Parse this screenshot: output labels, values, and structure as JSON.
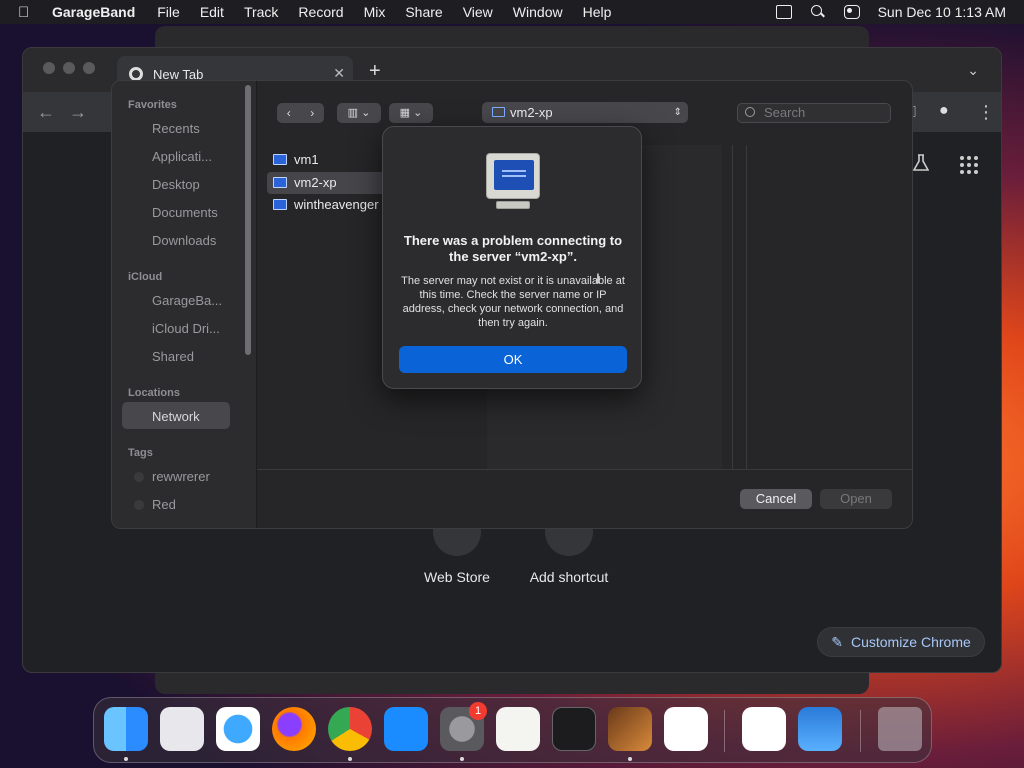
{
  "menubar": {
    "app_name": "GarageBand",
    "items": [
      "File",
      "Edit",
      "Track",
      "Record",
      "Mix",
      "Share",
      "View",
      "Window",
      "Help"
    ],
    "clock": "Sun Dec 10  1:13 AM"
  },
  "chrome": {
    "tab_title": "New Tab",
    "shortcuts": [
      {
        "label": "Web Store"
      },
      {
        "label": "Add shortcut"
      }
    ],
    "customize_label": "Customize Chrome"
  },
  "open_dialog": {
    "sidebar": {
      "favorites_heading": "Favorites",
      "favorites": [
        "Recents",
        "Applicati...",
        "Desktop",
        "Documents",
        "Downloads"
      ],
      "icloud_heading": "iCloud",
      "icloud": [
        "GarageBa...",
        "iCloud Dri...",
        "Shared"
      ],
      "locations_heading": "Locations",
      "locations": [
        "Network"
      ],
      "tags_heading": "Tags",
      "tags": [
        "rewwrerer",
        "Red"
      ]
    },
    "path_label": "vm2-xp",
    "search_placeholder": "Search",
    "files": [
      "vm1",
      "vm2-xp",
      "wintheavenger"
    ],
    "selected_file": "vm2-xp",
    "cancel_label": "Cancel",
    "open_label": "Open"
  },
  "alert": {
    "title": "There was a problem connecting to the server “vm2-xp”.",
    "message": "The server may not exist or it is unavailable at this time. Check the server name or IP address, check your network connection, and then try again.",
    "ok_label": "OK"
  },
  "dock": {
    "apps": [
      "finder-icon",
      "launchpad-icon",
      "safari-icon",
      "firefox-icon",
      "chrome-icon",
      "app-store-icon",
      "system-settings-icon",
      "textedit-icon",
      "terminal-icon",
      "garageband-icon",
      "vscode-icon",
      "visual-studio-icon",
      "weather-icon",
      "trash-icon"
    ],
    "settings_badge": "1"
  },
  "colors": {
    "accent": "#0a64d8",
    "link": "#a8c7fa"
  }
}
